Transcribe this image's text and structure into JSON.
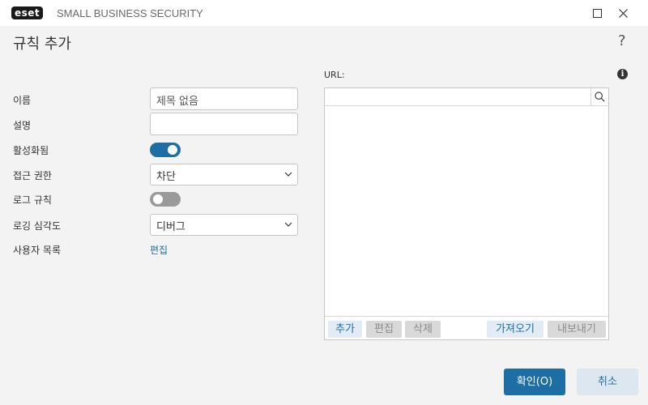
{
  "window": {
    "logo_text": "eset",
    "product": "SMALL BUSINESS SECURITY",
    "minimize_icon": "minimize-icon",
    "close_icon": "close-icon"
  },
  "dialog": {
    "title": "규칙 추가",
    "help": "?"
  },
  "form": {
    "name_label": "이름",
    "name_value": "제목 없음",
    "description_label": "설명",
    "description_value": "",
    "enabled_label": "활성화됨",
    "enabled": true,
    "access_label": "접근 권한",
    "access_value": "차단",
    "log_rule_label": "로그 규칙",
    "log_rule": false,
    "log_severity_label": "로깅 심각도",
    "log_severity_value": "디버그",
    "user_list_label": "사용자 목록",
    "user_list_link": "편집"
  },
  "url_panel": {
    "label": "URL:",
    "info_icon": "info-icon",
    "search_placeholder": "",
    "actions": {
      "add": "추가",
      "edit": "편집",
      "delete": "삭제",
      "import": "가져오기",
      "export": "내보내기"
    }
  },
  "footer": {
    "ok": "확인(O)",
    "cancel": "취소"
  },
  "colors": {
    "accent": "#1c6ea4",
    "background": "#f3f3f3"
  }
}
